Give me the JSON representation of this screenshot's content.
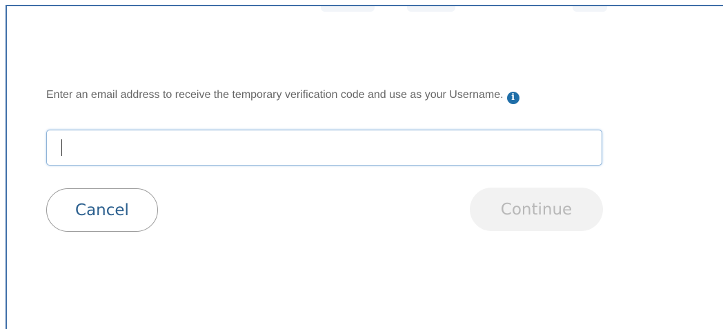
{
  "form": {
    "instructions": "Enter an email address to receive the temporary verification code and use as your Username.",
    "info_icon": "info-icon",
    "email_value": "",
    "cancel_label": "Cancel",
    "continue_label": "Continue",
    "continue_state": "disabled"
  },
  "colors": {
    "frame_border": "#3f6fa8",
    "info_icon": "#1f6ea8",
    "cancel_text": "#2b5f8e",
    "input_border": "#8fb4d8",
    "continue_bg": "#f2f2f2",
    "continue_text": "#b8b8b8"
  }
}
